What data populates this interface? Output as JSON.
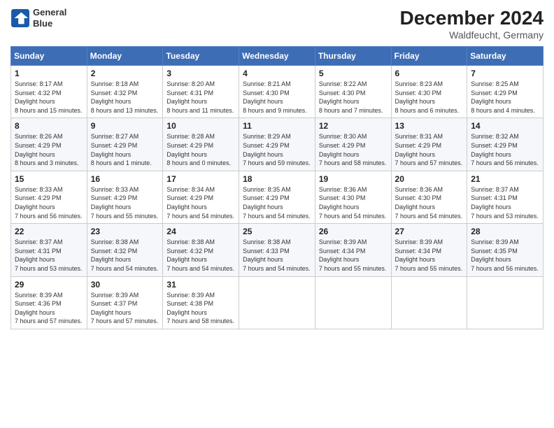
{
  "header": {
    "logo_line1": "General",
    "logo_line2": "Blue",
    "month": "December 2024",
    "location": "Waldfeucht, Germany"
  },
  "days_of_week": [
    "Sunday",
    "Monday",
    "Tuesday",
    "Wednesday",
    "Thursday",
    "Friday",
    "Saturday"
  ],
  "weeks": [
    [
      {
        "day": "1",
        "sunrise": "8:17 AM",
        "sunset": "4:32 PM",
        "daylight": "8 hours and 15 minutes."
      },
      {
        "day": "2",
        "sunrise": "8:18 AM",
        "sunset": "4:32 PM",
        "daylight": "8 hours and 13 minutes."
      },
      {
        "day": "3",
        "sunrise": "8:20 AM",
        "sunset": "4:31 PM",
        "daylight": "8 hours and 11 minutes."
      },
      {
        "day": "4",
        "sunrise": "8:21 AM",
        "sunset": "4:30 PM",
        "daylight": "8 hours and 9 minutes."
      },
      {
        "day": "5",
        "sunrise": "8:22 AM",
        "sunset": "4:30 PM",
        "daylight": "8 hours and 7 minutes."
      },
      {
        "day": "6",
        "sunrise": "8:23 AM",
        "sunset": "4:30 PM",
        "daylight": "8 hours and 6 minutes."
      },
      {
        "day": "7",
        "sunrise": "8:25 AM",
        "sunset": "4:29 PM",
        "daylight": "8 hours and 4 minutes."
      }
    ],
    [
      {
        "day": "8",
        "sunrise": "8:26 AM",
        "sunset": "4:29 PM",
        "daylight": "8 hours and 3 minutes."
      },
      {
        "day": "9",
        "sunrise": "8:27 AM",
        "sunset": "4:29 PM",
        "daylight": "8 hours and 1 minute."
      },
      {
        "day": "10",
        "sunrise": "8:28 AM",
        "sunset": "4:29 PM",
        "daylight": "8 hours and 0 minutes."
      },
      {
        "day": "11",
        "sunrise": "8:29 AM",
        "sunset": "4:29 PM",
        "daylight": "7 hours and 59 minutes."
      },
      {
        "day": "12",
        "sunrise": "8:30 AM",
        "sunset": "4:29 PM",
        "daylight": "7 hours and 58 minutes."
      },
      {
        "day": "13",
        "sunrise": "8:31 AM",
        "sunset": "4:29 PM",
        "daylight": "7 hours and 57 minutes."
      },
      {
        "day": "14",
        "sunrise": "8:32 AM",
        "sunset": "4:29 PM",
        "daylight": "7 hours and 56 minutes."
      }
    ],
    [
      {
        "day": "15",
        "sunrise": "8:33 AM",
        "sunset": "4:29 PM",
        "daylight": "7 hours and 56 minutes."
      },
      {
        "day": "16",
        "sunrise": "8:33 AM",
        "sunset": "4:29 PM",
        "daylight": "7 hours and 55 minutes."
      },
      {
        "day": "17",
        "sunrise": "8:34 AM",
        "sunset": "4:29 PM",
        "daylight": "7 hours and 54 minutes."
      },
      {
        "day": "18",
        "sunrise": "8:35 AM",
        "sunset": "4:29 PM",
        "daylight": "7 hours and 54 minutes."
      },
      {
        "day": "19",
        "sunrise": "8:36 AM",
        "sunset": "4:30 PM",
        "daylight": "7 hours and 54 minutes."
      },
      {
        "day": "20",
        "sunrise": "8:36 AM",
        "sunset": "4:30 PM",
        "daylight": "7 hours and 54 minutes."
      },
      {
        "day": "21",
        "sunrise": "8:37 AM",
        "sunset": "4:31 PM",
        "daylight": "7 hours and 53 minutes."
      }
    ],
    [
      {
        "day": "22",
        "sunrise": "8:37 AM",
        "sunset": "4:31 PM",
        "daylight": "7 hours and 53 minutes."
      },
      {
        "day": "23",
        "sunrise": "8:38 AM",
        "sunset": "4:32 PM",
        "daylight": "7 hours and 54 minutes."
      },
      {
        "day": "24",
        "sunrise": "8:38 AM",
        "sunset": "4:32 PM",
        "daylight": "7 hours and 54 minutes."
      },
      {
        "day": "25",
        "sunrise": "8:38 AM",
        "sunset": "4:33 PM",
        "daylight": "7 hours and 54 minutes."
      },
      {
        "day": "26",
        "sunrise": "8:39 AM",
        "sunset": "4:34 PM",
        "daylight": "7 hours and 55 minutes."
      },
      {
        "day": "27",
        "sunrise": "8:39 AM",
        "sunset": "4:34 PM",
        "daylight": "7 hours and 55 minutes."
      },
      {
        "day": "28",
        "sunrise": "8:39 AM",
        "sunset": "4:35 PM",
        "daylight": "7 hours and 56 minutes."
      }
    ],
    [
      {
        "day": "29",
        "sunrise": "8:39 AM",
        "sunset": "4:36 PM",
        "daylight": "7 hours and 57 minutes."
      },
      {
        "day": "30",
        "sunrise": "8:39 AM",
        "sunset": "4:37 PM",
        "daylight": "7 hours and 57 minutes."
      },
      {
        "day": "31",
        "sunrise": "8:39 AM",
        "sunset": "4:38 PM",
        "daylight": "7 hours and 58 minutes."
      },
      null,
      null,
      null,
      null
    ]
  ]
}
